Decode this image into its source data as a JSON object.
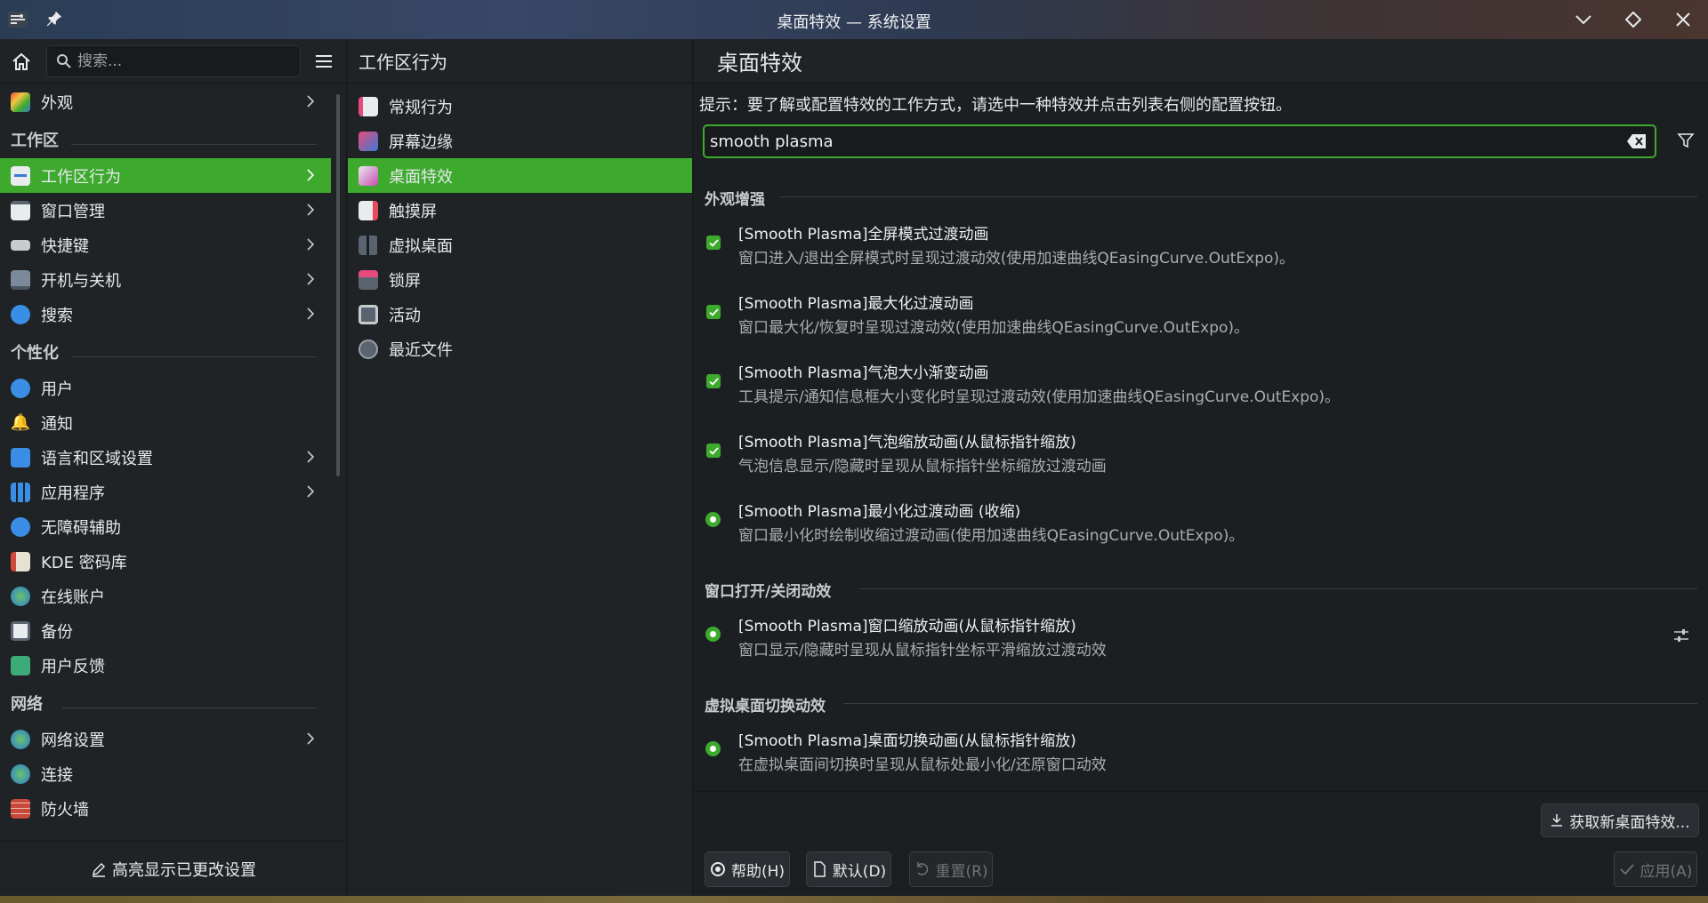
{
  "window": {
    "title": "桌面特效 — 系统设置"
  },
  "sidebar": {
    "search_placeholder": "搜索...",
    "top_items": [
      {
        "label": "外观"
      }
    ],
    "categories": [
      {
        "title": "工作区",
        "items": [
          {
            "label": "工作区行为"
          },
          {
            "label": "窗口管理"
          },
          {
            "label": "快捷键"
          },
          {
            "label": "开机与关机"
          },
          {
            "label": "搜索"
          }
        ]
      },
      {
        "title": "个性化",
        "items": [
          {
            "label": "用户"
          },
          {
            "label": "通知"
          },
          {
            "label": "语言和区域设置"
          },
          {
            "label": "应用程序"
          },
          {
            "label": "无障碍辅助"
          },
          {
            "label": "KDE 密码库"
          },
          {
            "label": "在线账户"
          },
          {
            "label": "备份"
          },
          {
            "label": "用户反馈"
          }
        ]
      },
      {
        "title": "网络",
        "items": [
          {
            "label": "网络设置"
          },
          {
            "label": "连接"
          },
          {
            "label": "防火墙"
          }
        ]
      }
    ],
    "highlight_label": "高亮显示已更改设置"
  },
  "middle": {
    "header": "工作区行为",
    "items": [
      {
        "label": "常规行为"
      },
      {
        "label": "屏幕边缘"
      },
      {
        "label": "桌面特效"
      },
      {
        "label": "触摸屏"
      },
      {
        "label": "虚拟桌面"
      },
      {
        "label": "锁屏"
      },
      {
        "label": "活动"
      },
      {
        "label": "最近文件"
      }
    ]
  },
  "content": {
    "header": "桌面特效",
    "hint": "提示：要了解或配置特效的工作方式，请选中一种特效并点击列表右侧的配置按钮。",
    "filter_value": "smooth plasma",
    "groups": [
      {
        "title": "外观增强",
        "effects": [
          {
            "name": "[Smooth Plasma]全屏模式过渡动画",
            "desc": "窗口进入/退出全屏模式时呈现过渡动效(使用加速曲线QEasingCurve.OutExpo)。"
          },
          {
            "name": "[Smooth Plasma]最大化过渡动画",
            "desc": "窗口最大化/恢复时呈现过渡动效(使用加速曲线QEasingCurve.OutExpo)。"
          },
          {
            "name": "[Smooth Plasma]气泡大小渐变动画",
            "desc": "工具提示/通知信息框大小变化时呈现过渡动效(使用加速曲线QEasingCurve.OutExpo)。"
          },
          {
            "name": "[Smooth Plasma]气泡缩放动画(从鼠标指针缩放)",
            "desc": "气泡信息显示/隐藏时呈现从鼠标指针坐标缩放过渡动画"
          },
          {
            "name": "[Smooth Plasma]最小化过渡动画 (收缩)",
            "desc": "窗口最小化时绘制收缩过渡动画(使用加速曲线QEasingCurve.OutExpo)。"
          }
        ]
      },
      {
        "title": "窗口打开/关闭动效",
        "effects": [
          {
            "name": "[Smooth Plasma]窗口缩放动画(从鼠标指针缩放)",
            "desc": "窗口显示/隐藏时呈现从鼠标指针坐标平滑缩放过渡动效"
          }
        ]
      },
      {
        "title": "虚拟桌面切换动效",
        "effects": [
          {
            "name": "[Smooth Plasma]桌面切换动画(从鼠标指针缩放)",
            "desc": "在虚拟桌面间切换时呈现从鼠标处最小化/还原窗口动效"
          }
        ]
      }
    ],
    "get_new_label": "获取新桌面特效...",
    "buttons": {
      "help": "帮助(H)",
      "defaults": "默认(D)",
      "reset": "重置(R)",
      "apply": "应用(A)"
    }
  },
  "colors": {
    "accent": "#3daa2e",
    "background": "#1c1f22",
    "panel": "#202326"
  }
}
